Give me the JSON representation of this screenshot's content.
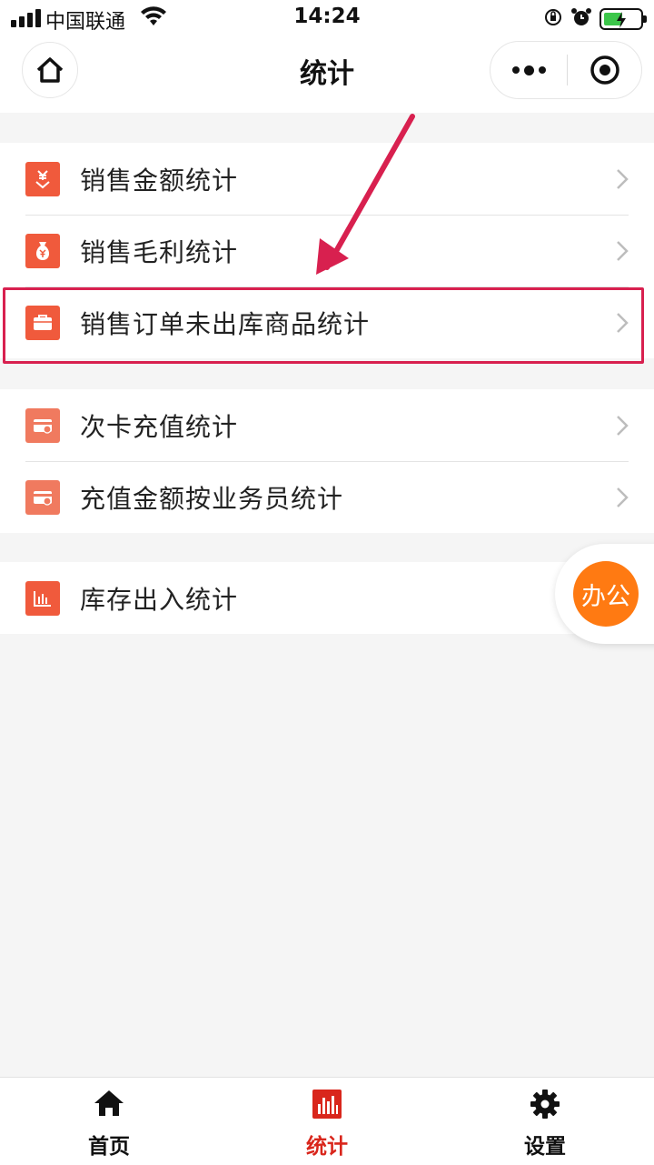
{
  "status_bar": {
    "carrier": "中国联通",
    "time": "14:24"
  },
  "nav": {
    "title": "统计"
  },
  "groups": [
    {
      "items": [
        {
          "label": "销售金额统计",
          "icon": "yen-arrow-icon"
        },
        {
          "label": "销售毛利统计",
          "icon": "money-bag-icon"
        },
        {
          "label": "销售订单未出库商品统计",
          "icon": "box-icon"
        }
      ]
    },
    {
      "items": [
        {
          "label": "次卡充值统计",
          "icon": "card-icon"
        },
        {
          "label": "充值金额按业务员统计",
          "icon": "card-icon"
        }
      ]
    },
    {
      "items": [
        {
          "label": "库存出入统计",
          "icon": "bar-chart-icon"
        }
      ]
    }
  ],
  "floating_button": {
    "label": "办公"
  },
  "tabbar": {
    "tabs": [
      {
        "label": "首页",
        "icon": "home-icon"
      },
      {
        "label": "统计",
        "icon": "bar-chart-icon",
        "active": true
      },
      {
        "label": "设置",
        "icon": "gear-icon"
      }
    ]
  },
  "colors": {
    "accent": "#d9261c",
    "icon_bg": "#f05a3c",
    "highlight": "#d8204f",
    "float": "#ff7a12"
  }
}
